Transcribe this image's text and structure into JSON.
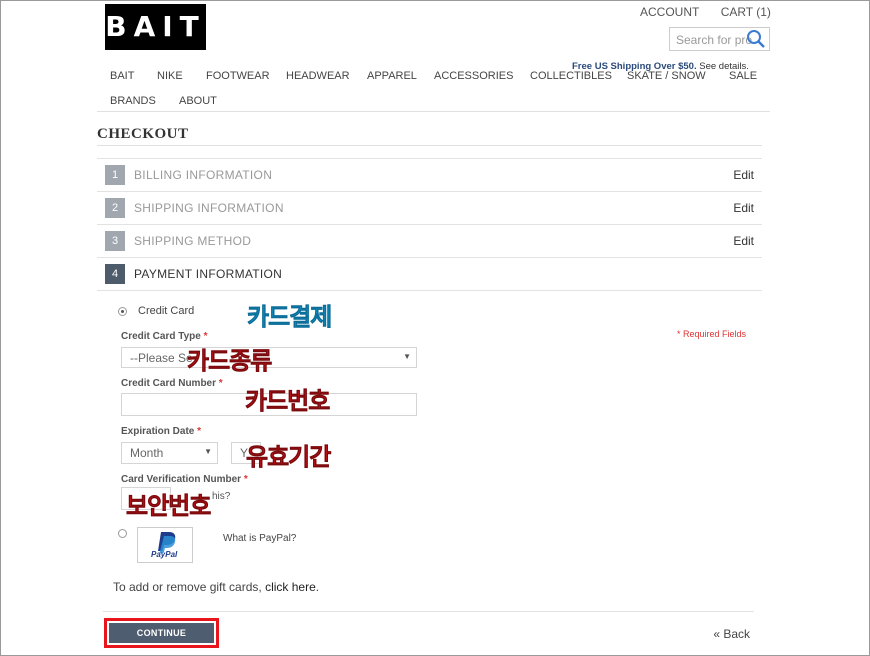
{
  "header": {
    "logo_text": "BAIT",
    "account_label": "ACCOUNT",
    "cart_label": "CART (1)",
    "search_placeholder": "Search for pro",
    "shipping_bold": "Free US Shipping Over $50.",
    "shipping_link": "See details."
  },
  "nav": {
    "items": [
      "BAIT",
      "NIKE",
      "FOOTWEAR",
      "HEADWEAR",
      "APPAREL",
      "ACCESSORIES",
      "COLLECTIBLES",
      "SKATE / SNOW",
      "SALE",
      "BRANDS",
      "ABOUT"
    ]
  },
  "checkout": {
    "title": "CHECKOUT",
    "steps": [
      {
        "num": "1",
        "label": "BILLING INFORMATION",
        "edit": "Edit"
      },
      {
        "num": "2",
        "label": "SHIPPING INFORMATION",
        "edit": "Edit"
      },
      {
        "num": "3",
        "label": "SHIPPING METHOD",
        "edit": "Edit"
      },
      {
        "num": "4",
        "label": "PAYMENT INFORMATION"
      }
    ]
  },
  "payment": {
    "credit_card_label": "Credit Card",
    "card_type_label": "Credit Card Type",
    "required_star": "*",
    "required_note": "* Required Fields",
    "card_type_value": "--Please Se",
    "card_number_label": "Credit Card Number",
    "expiration_label": "Expiration Date",
    "month_value": "Month",
    "year_value": "Y",
    "cvv_label": "Card Verification Number",
    "cvv_hint": "his?",
    "paypal_text": "PayPal",
    "what_is_paypal": "What is PayPal?",
    "gift_text": "To add or remove gift cards, ",
    "gift_link": "click here",
    "gift_period": "."
  },
  "annotations": {
    "credit_card_payment": "카드결제",
    "card_type": "카드종류",
    "card_number": "카드번호",
    "expiration": "유효기간",
    "security_code": "보안번호"
  },
  "footer": {
    "continue_label": "CONTINUE",
    "back_label": "« Back"
  },
  "colors": {
    "accent": "#4f5d70",
    "highlight_box": "#e8151c",
    "annotation_blue": "#17a0d6",
    "annotation_red": "#e3141b"
  }
}
